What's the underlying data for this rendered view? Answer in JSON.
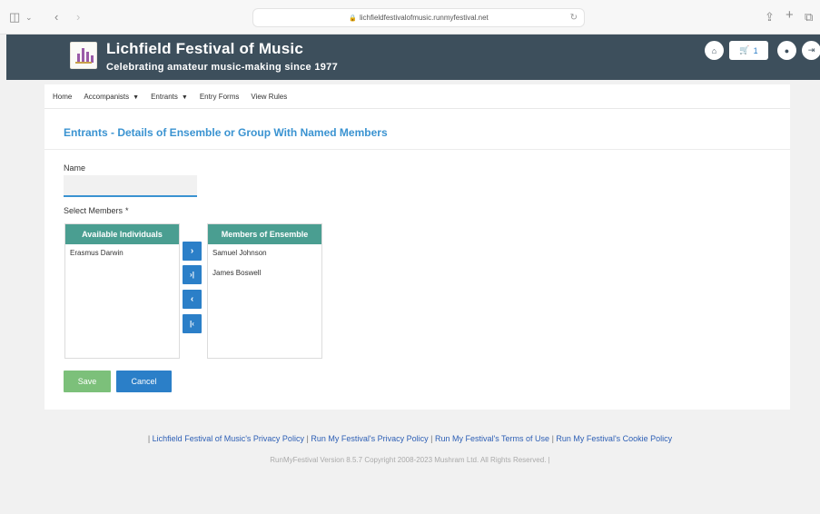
{
  "browser": {
    "url": "lichfieldfestivalofmusic.runmyfestival.net",
    "icons": [
      "sidebar-icon",
      "chevron-down-icon",
      "back-icon",
      "forward-icon",
      "lock-icon",
      "reload-icon",
      "share-icon",
      "new-tab-icon",
      "tabs-icon"
    ]
  },
  "site": {
    "title": "Lichfield Festival of Music",
    "tagline": "Celebrating amateur music-making since 1977",
    "cart_count": "1",
    "header_color": "#3d4f5c"
  },
  "nav": {
    "items": [
      {
        "label": "Home"
      },
      {
        "label": "Accompanists"
      },
      {
        "label": "Entrants"
      },
      {
        "label": "Entry Forms"
      },
      {
        "label": "View Rules"
      }
    ]
  },
  "form": {
    "page_title": "Entrants - Details of Ensemble or Group With Named Members",
    "name_label": "Name",
    "name_value": "",
    "members_label": "Select Members",
    "required_mark": "*",
    "available_header": "Available Individuals",
    "available_items": [
      "Erasmus Darwin"
    ],
    "members_header": "Members of Ensemble",
    "member_items": [
      "Samuel Johnson",
      "James Boswell"
    ],
    "move_buttons": [
      {
        "glyph": "›"
      },
      {
        "glyph": "›|"
      },
      {
        "glyph": "‹"
      },
      {
        "glyph": "|‹"
      }
    ],
    "save_label": "Save",
    "cancel_label": "Cancel",
    "accent_color": "#3a93d1",
    "list_header_color": "#4a9e91"
  },
  "footer": {
    "links": [
      "Lichfield Festival of Music's Privacy Policy",
      "Run My Festival's Privacy Policy",
      "Run My Festival's Terms of Use",
      "Run My Festival's Cookie Policy"
    ],
    "separator": "|",
    "copyright": "RunMyFestival Version 8.5.7 Copyright 2008-2023 Mushram Ltd. All Rights Reserved. |"
  }
}
